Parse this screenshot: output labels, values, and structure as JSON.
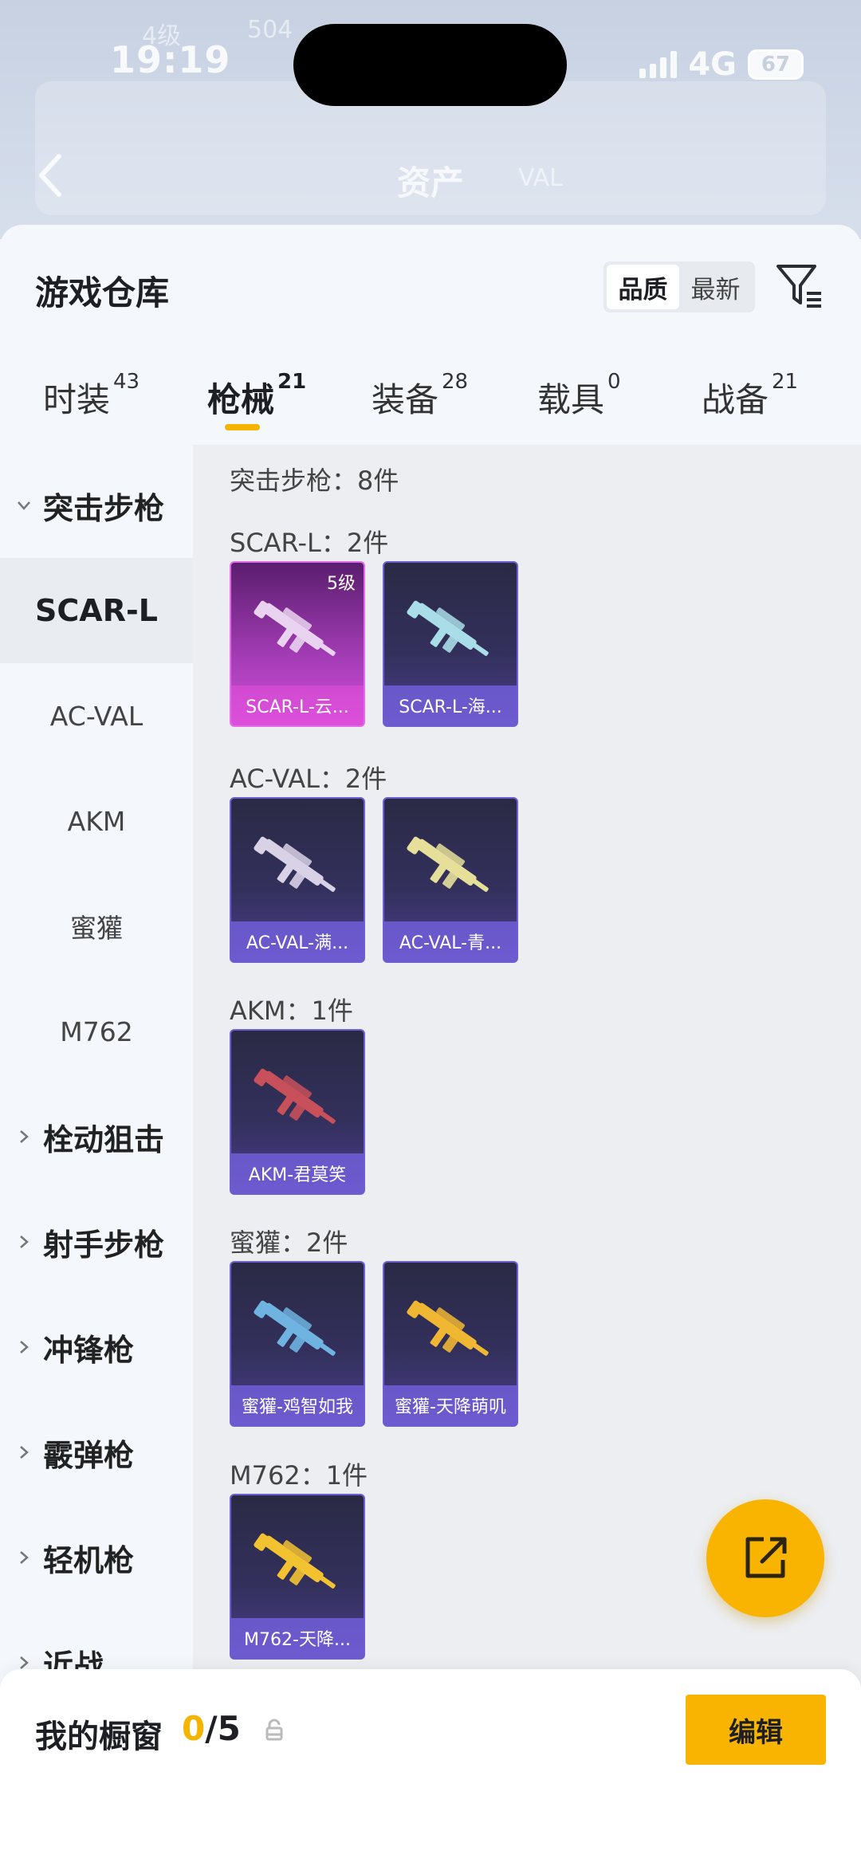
{
  "status_bar": {
    "time": "19:19",
    "network": "4G",
    "battery": "67"
  },
  "background_header": {
    "title": "资产",
    "faint_level": "4级",
    "faint_count": "504",
    "faint_val": "VAL"
  },
  "header": {
    "title": "游戏仓库",
    "sort_options": [
      "品质",
      "最新"
    ],
    "sort_selected": "品质"
  },
  "tabs": [
    {
      "label": "时装",
      "count": "43"
    },
    {
      "label": "枪械",
      "count": "21",
      "active": true
    },
    {
      "label": "装备",
      "count": "28"
    },
    {
      "label": "载具",
      "count": "0"
    },
    {
      "label": "战备",
      "count": "21"
    }
  ],
  "sidebar": {
    "groups": [
      {
        "label": "突击步枪",
        "expanded": true
      },
      {
        "label": "栓动狙击"
      },
      {
        "label": "射手步枪"
      },
      {
        "label": "冲锋枪"
      },
      {
        "label": "霰弹枪"
      },
      {
        "label": "轻机枪"
      },
      {
        "label": "近战"
      }
    ],
    "sub_items": [
      "SCAR-L",
      "AC-VAL",
      "AKM",
      "蜜獾",
      "M762"
    ],
    "selected_sub": "SCAR-L"
  },
  "content": {
    "category_summary": "突击步枪：8件",
    "sections": [
      {
        "label": "SCAR-L：2件",
        "items": [
          {
            "name": "SCAR-L-云...",
            "level": "5级",
            "rarity": "legendary",
            "gun_color": "#e9d3f0"
          },
          {
            "name": "SCAR-L-海...",
            "rarity": "epic",
            "gun_color": "#a9dde8"
          }
        ]
      },
      {
        "label": "AC-VAL：2件",
        "items": [
          {
            "name": "AC-VAL-满...",
            "rarity": "epic",
            "gun_color": "#d9d2e6"
          },
          {
            "name": "AC-VAL-青...",
            "rarity": "epic",
            "gun_color": "#e6df9a"
          }
        ]
      },
      {
        "label": "AKM：1件",
        "items": [
          {
            "name": "AKM-君莫笑",
            "rarity": "epic",
            "gun_color": "#c8505a"
          }
        ]
      },
      {
        "label": "蜜獾：2件",
        "items": [
          {
            "name": "蜜獾-鸡智如我",
            "rarity": "epic",
            "gun_color": "#6fb3e0"
          },
          {
            "name": "蜜獾-天降萌叽",
            "rarity": "epic",
            "gun_color": "#f0b732"
          }
        ]
      },
      {
        "label": "M762：1件",
        "items": [
          {
            "name": "M762-天降...",
            "rarity": "epic",
            "gun_color": "#f2c230"
          }
        ]
      }
    ]
  },
  "bottom_bar": {
    "label": "我的橱窗",
    "current": "0",
    "total": "/5",
    "edit_label": "编辑"
  },
  "colors": {
    "accent": "#f8b400",
    "epic_card": "#4a3d8c",
    "legendary_card": "#d24fd8"
  }
}
